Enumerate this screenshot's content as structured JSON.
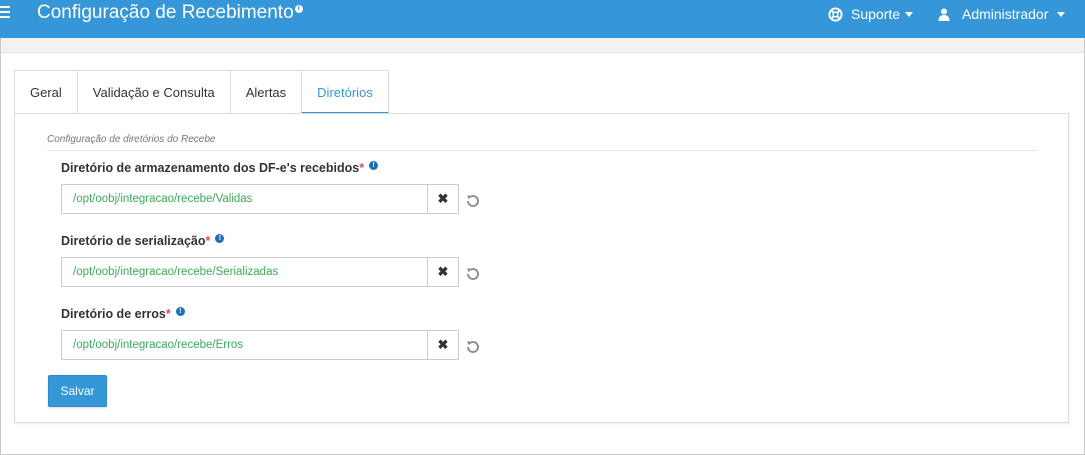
{
  "header": {
    "title": "Configuração de Recebimento",
    "title_info": "i",
    "support_label": "Suporte",
    "user_label": "Administrador"
  },
  "tabs": [
    {
      "label": "Geral",
      "active": false
    },
    {
      "label": "Validação e Consulta",
      "active": false
    },
    {
      "label": "Alertas",
      "active": false
    },
    {
      "label": "Diretórios",
      "active": true
    }
  ],
  "section": {
    "legend": "Configuração de diretórios do Recebe"
  },
  "fields": [
    {
      "label": "Diretório de armazenamento dos DF-e's recebidos",
      "required": "*",
      "value": "/opt/oobj/integracao/recebe/Validas",
      "info": "!"
    },
    {
      "label": "Diretório de serialização",
      "required": "*",
      "value": "/opt/oobj/integracao/recebe/Serializadas",
      "info": "!"
    },
    {
      "label": "Diretório de erros",
      "required": "*",
      "value": "/opt/oobj/integracao/recebe/Erros",
      "info": "!"
    }
  ],
  "clear_symbol": "✖",
  "save_label": "Salvar",
  "colors": {
    "primary": "#3597d8",
    "path_text": "#3cab5b",
    "required": "#d9534f",
    "info": "#1d6fb8"
  }
}
